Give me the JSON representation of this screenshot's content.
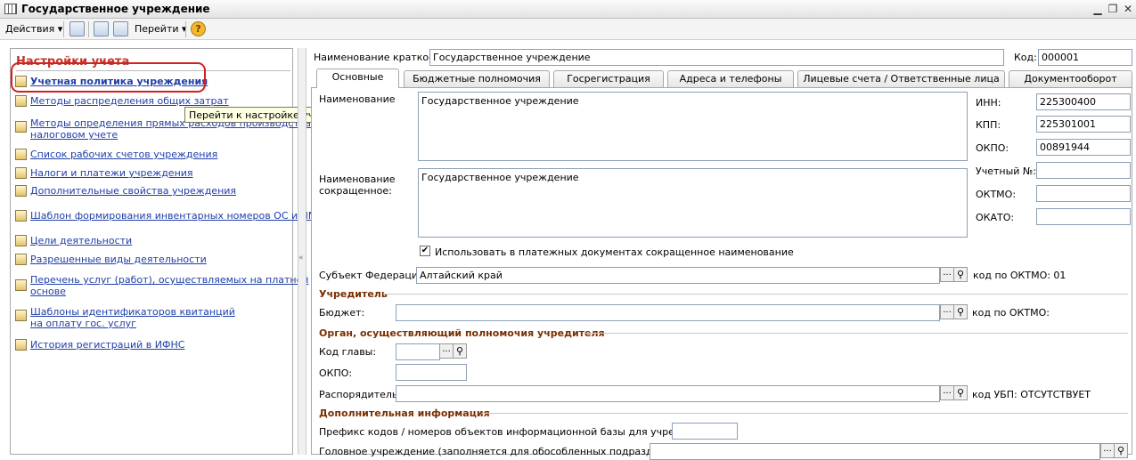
{
  "window": {
    "title": "Государственное учреждение"
  },
  "toolbar": {
    "actions": "Действия",
    "goto": "Перейти"
  },
  "left": {
    "title": "Настройки учета",
    "links": [
      "Учетная политика учреждения",
      "Методы распределения общих затрат",
      "Методы определения прямых расходов производства в",
      "налоговом учете",
      "Список рабочих счетов учреждения",
      "Налоги и платежи учреждения",
      "Дополнительные свойства учреждения",
      "Шаблон формирования инвентарных номеров ОС и НМА",
      "Цели деятельности",
      "Разрешенные виды деятельности",
      "Перечень услуг (работ), осуществляемых на платной",
      "основе",
      "Шаблоны идентификаторов квитанций",
      "на оплату гос. услуг",
      "История регистраций в ИФНС"
    ],
    "tooltip": "Перейти к настройке учетной политики учреждения"
  },
  "header": {
    "short_name_label": "Наименование краткое:",
    "short_name": "Государственное учреждение",
    "code_label": "Код:",
    "code": "000001"
  },
  "tabs": [
    "Основные",
    "Бюджетные полномочия",
    "Госрегистрация",
    "Адреса и телефоны",
    "Лицевые счета / Ответственные лица",
    "Документооборот"
  ],
  "main": {
    "name_label": "Наименование",
    "name": "Государственное учреждение",
    "short_label_1": "Наименование",
    "short_label_2": "сокращенное:",
    "short_name": "Государственное учреждение",
    "inn_label": "ИНН:",
    "inn": "225300400",
    "kpp_label": "КПП:",
    "kpp": "225301001",
    "okpo_label": "ОКПО:",
    "okpo": "00891944",
    "reg_label": "Учетный №:",
    "oktmo_label": "ОКТМО:",
    "okato_label": "ОКАТО:",
    "use_short_label": "Использовать в платежных документах сокращенное наименование",
    "subject_label": "Субъект Федерации:",
    "subject": "Алтайский край",
    "subject_oktmo": "код по ОКТМО: 01",
    "founder_section": "Учредитель",
    "budget_label": "Бюджет:",
    "budget_oktmo": "код по ОКТМО:",
    "organ_section": "Орган, осуществляющий полномочия учредителя",
    "head_code_label": "Код главы:",
    "okpo2_label": "ОКПО:",
    "manager_label": "Распорядитель:",
    "ubp": "код УБП: ОТСУТСТВУЕТ",
    "extra_section": "Дополнительная информация",
    "prefix_label": "Префикс кодов / номеров объектов информационной базы для учреждения:",
    "head_org_label": "Головное учреждение (заполняется для обособленных подразделений):"
  }
}
